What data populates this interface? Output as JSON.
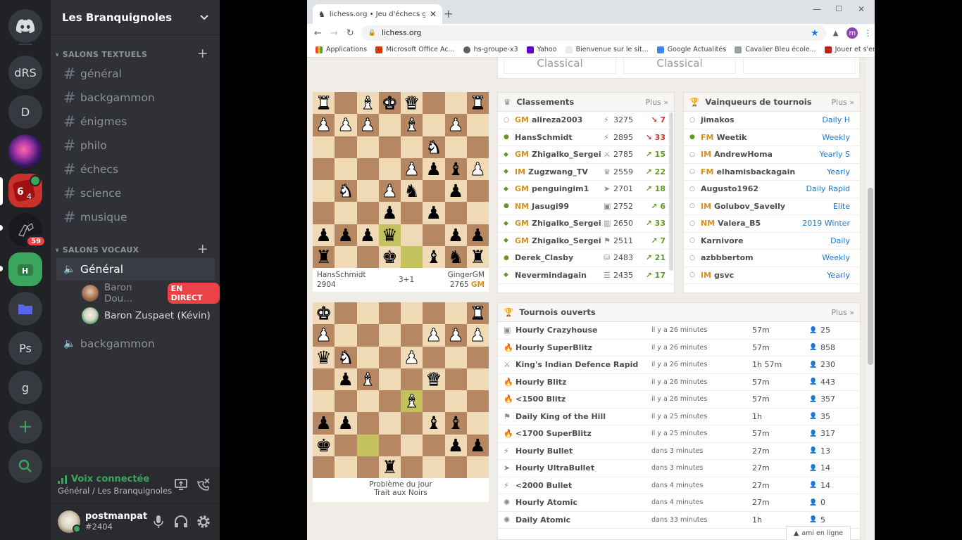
{
  "discord": {
    "servers": [
      {
        "label": "dRS"
      },
      {
        "label": "D"
      },
      {
        "label": "Ps"
      },
      {
        "label": "g"
      }
    ],
    "mention_badge": "59",
    "guild_name": "Les Branquignoles",
    "text_category": "SALONS TEXTUELS",
    "text_channels": [
      "général",
      "backgammon",
      "énigmes",
      "philo",
      "échecs",
      "science",
      "musique"
    ],
    "voice_category": "SALONS VOCAUX",
    "voice_channels": [
      "Général",
      "backgammon"
    ],
    "voice_users": [
      {
        "name": "Baron Dou...",
        "badge": "EN DIRECT"
      },
      {
        "name": "Baron Zuspaet (Kévin)"
      }
    ],
    "voice_status": "Voix connectée",
    "voice_location": "Général / Les Branquignoles",
    "username": "postmanpat",
    "discriminator": "#2404",
    "colors": {
      "green": "#3ba55d",
      "red": "#ed4245",
      "blurple": "#5865f2"
    }
  },
  "browser": {
    "tab_title": "lichess.org • Jeu d'échecs gratuit",
    "url": "lichess.org",
    "profile_initial": "m",
    "bookmarks": [
      "Applications",
      "Microsoft Office Ac...",
      "hs-groupe-x3",
      "Yahoo",
      "Bienvenue sur le sit...",
      "Google Actualités",
      "Cavalier Bleu école...",
      "Jouer et s'entrainer..."
    ]
  },
  "lichess": {
    "top_cards": [
      "Classical",
      "Classical"
    ],
    "board1": {
      "rows": [
        [
          "wR",
          "d",
          "wB",
          "wK",
          "wQ",
          "d",
          "l",
          "wR"
        ],
        [
          "wP",
          "wP",
          "wP",
          "d",
          "wB",
          "d",
          "wP",
          "d"
        ],
        [
          "d",
          "l",
          "d",
          "l",
          "d",
          "wN",
          "d",
          "l"
        ],
        [
          "l",
          "d",
          "l",
          "d",
          "wP",
          "bP",
          "bB",
          "wP"
        ],
        [
          "d",
          "wN",
          "d",
          "wP",
          "bN",
          "l",
          "bP",
          "l"
        ],
        [
          "l",
          "d",
          "l",
          "bP",
          "l",
          "bP",
          "l",
          "d"
        ],
        [
          "bP",
          "bP",
          "bP",
          "bQ",
          "d",
          "l",
          "bP",
          "bP"
        ],
        [
          "bR",
          "d",
          "l",
          "bK",
          "H",
          "bB",
          "bN",
          "bR"
        ]
      ],
      "hl": [
        [
          6,
          3
        ],
        [
          7,
          4
        ]
      ],
      "white_player": "HansSchmidt",
      "white_rating": "2904",
      "clock": "3+1",
      "black_player": "GingerGM",
      "black_rating": "2765",
      "black_title": "GM"
    },
    "board2": {
      "rows": [
        [
          "wK",
          "d",
          "l",
          "d",
          "l",
          "d",
          "l",
          "wR"
        ],
        [
          "wP",
          "l",
          "d",
          "l",
          "d",
          "wP",
          "wP",
          "wP"
        ],
        [
          "bQ",
          "wN",
          "l",
          "d",
          "wP",
          "d",
          "l",
          "d"
        ],
        [
          "d",
          "bP",
          "wB",
          "l",
          "d",
          "wQ",
          "d",
          "l"
        ],
        [
          "l",
          "d",
          "l",
          "d",
          "wB",
          "l",
          "d",
          "l"
        ],
        [
          "bP",
          "bP",
          "d",
          "l",
          "d",
          "bB",
          "bB",
          "d"
        ],
        [
          "bK",
          "l",
          "H",
          "d",
          "l",
          "d",
          "bP",
          "bP"
        ],
        [
          "l",
          "d",
          "l",
          "bR",
          "l",
          "d",
          "l",
          "d"
        ]
      ],
      "hl": [
        [
          4,
          4
        ],
        [
          6,
          2
        ]
      ],
      "caption1": "Problème du jour",
      "caption2": "Trait aux Noirs"
    },
    "leaderboard": {
      "title": "Classements",
      "more": "Plus »",
      "rows": [
        {
          "title": "GM",
          "name": "alireza2003",
          "rating": "3275",
          "diff": "7",
          "dir": "down",
          "icon": "⚡",
          "status": "○"
        },
        {
          "title": "",
          "name": "HansSchmidt",
          "rating": "2895",
          "diff": "33",
          "dir": "down",
          "icon": "⚡",
          "status": "●"
        },
        {
          "title": "GM",
          "name": "Zhigalko_Sergei",
          "rating": "2785",
          "diff": "15",
          "dir": "up",
          "icon": "⚔",
          "status": "◆"
        },
        {
          "title": "IM",
          "name": "Zugzwang_TV",
          "rating": "2559",
          "diff": "22",
          "dir": "up",
          "icon": "♛",
          "status": "◆"
        },
        {
          "title": "GM",
          "name": "penguingim1",
          "rating": "2701",
          "diff": "18",
          "dir": "up",
          "icon": "➤",
          "status": "◆"
        },
        {
          "title": "NM",
          "name": "Jasugi99",
          "rating": "2752",
          "diff": "6",
          "dir": "up",
          "icon": "▣",
          "status": "●"
        },
        {
          "title": "GM",
          "name": "Zhigalko_Sergei",
          "rating": "2650",
          "diff": "33",
          "dir": "up",
          "icon": "▥",
          "status": "◆"
        },
        {
          "title": "GM",
          "name": "Zhigalko_Sergei",
          "rating": "2511",
          "diff": "7",
          "dir": "up",
          "icon": "⚑",
          "status": "◆"
        },
        {
          "title": "",
          "name": "Derek_Clasby",
          "rating": "2483",
          "diff": "21",
          "dir": "up",
          "icon": "⛁",
          "status": "●"
        },
        {
          "title": "",
          "name": "Nevermindagain",
          "rating": "2435",
          "diff": "17",
          "dir": "up",
          "icon": "☰",
          "status": "◆"
        }
      ]
    },
    "winners": {
      "title": "Vainqueurs de tournois",
      "more": "Plus »",
      "rows": [
        {
          "title": "",
          "name": "jimakos",
          "event": "Daily H",
          "status": "○"
        },
        {
          "title": "FM",
          "name": "Weetik",
          "event": "Weekly",
          "status": "●"
        },
        {
          "title": "IM",
          "name": "AndrewHoma",
          "event": "Yearly S",
          "status": "○"
        },
        {
          "title": "FM",
          "name": "elhamisbackagain",
          "event": "Yearly",
          "status": "○"
        },
        {
          "title": "",
          "name": "Augusto1962",
          "event": "Daily Rapid",
          "status": "○"
        },
        {
          "title": "IM",
          "name": "Golubov_Savelly",
          "event": "Elite",
          "status": "○"
        },
        {
          "title": "NM",
          "name": "Valera_B5",
          "event": "2019 Winter",
          "status": "○"
        },
        {
          "title": "",
          "name": "Karnivore",
          "event": "Daily",
          "status": "○"
        },
        {
          "title": "",
          "name": "azbbbertom",
          "event": "Weekly",
          "status": "○"
        },
        {
          "title": "IM",
          "name": "gsvc",
          "event": "Yearly",
          "status": "○"
        }
      ]
    },
    "tournaments": {
      "title": "Tournois ouverts",
      "more": "Plus »",
      "rows": [
        {
          "icon": "▣",
          "name": "Hourly Crazyhouse",
          "when": "il y a 26 minutes",
          "duration": "57m",
          "players": "25"
        },
        {
          "icon": "🔥",
          "name": "Hourly SuperBlitz",
          "when": "il y a 26 minutes",
          "duration": "57m",
          "players": "858"
        },
        {
          "icon": "⚔",
          "name": "King's Indian Defence Rapid",
          "when": "il y a 26 minutes",
          "duration": "1h 57m",
          "players": "230"
        },
        {
          "icon": "🔥",
          "name": "Hourly Blitz",
          "when": "il y a 26 minutes",
          "duration": "57m",
          "players": "443"
        },
        {
          "icon": "🔥",
          "name": "<1500 Blitz",
          "when": "il y a 26 minutes",
          "duration": "57m",
          "players": "357"
        },
        {
          "icon": "⚑",
          "name": "Daily King of the Hill",
          "when": "il y a 25 minutes",
          "duration": "1h",
          "players": "35"
        },
        {
          "icon": "🔥",
          "name": "<1700 SuperBlitz",
          "when": "il y a 25 minutes",
          "duration": "57m",
          "players": "317"
        },
        {
          "icon": "⚡",
          "name": "Hourly Bullet",
          "when": "dans 3 minutes",
          "duration": "27m",
          "players": "13"
        },
        {
          "icon": "➤",
          "name": "Hourly UltraBullet",
          "when": "dans 3 minutes",
          "duration": "27m",
          "players": "14"
        },
        {
          "icon": "⚡",
          "name": "<2000 Bullet",
          "when": "dans 4 minutes",
          "duration": "27m",
          "players": "14"
        },
        {
          "icon": "✺",
          "name": "Hourly Atomic",
          "when": "dans 4 minutes",
          "duration": "27m",
          "players": "0"
        },
        {
          "icon": "✺",
          "name": "Daily Atomic",
          "when": "dans 33 minutes",
          "duration": "1h",
          "players": "5"
        }
      ]
    },
    "friends_online": "ami en ligne"
  }
}
